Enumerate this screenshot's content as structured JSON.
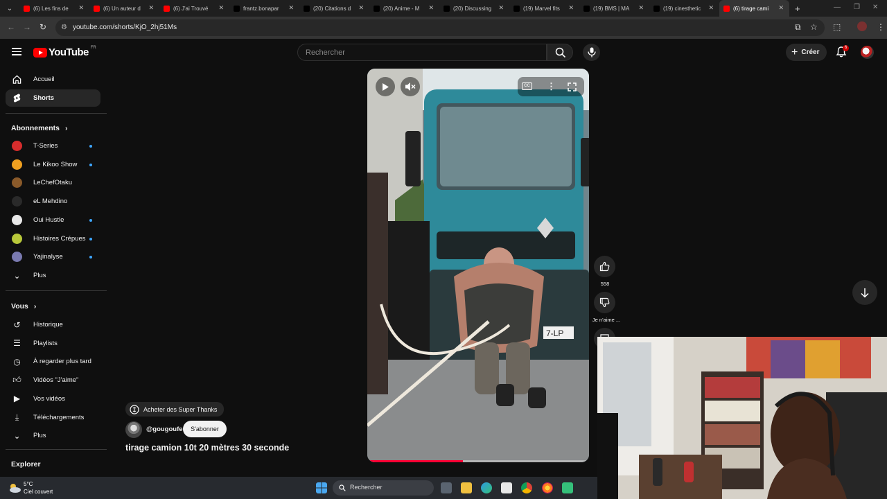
{
  "browser": {
    "tabs": [
      {
        "title": "(6) Les fins de",
        "icon": "youtube-icon",
        "color": "#ff0000"
      },
      {
        "title": "(6) Un auteur d",
        "icon": "youtube-icon",
        "color": "#ff0000"
      },
      {
        "title": "(6) J'ai Trouvé",
        "icon": "youtube-icon",
        "color": "#ff0000"
      },
      {
        "title": "frantz.bonapar",
        "icon": "tiktok-icon",
        "color": "#000000"
      },
      {
        "title": "(20) Citations d",
        "icon": "x-icon",
        "color": "#000000"
      },
      {
        "title": "(20) Anime - M",
        "icon": "x-icon",
        "color": "#000000"
      },
      {
        "title": "(20) Discussing",
        "icon": "x-icon",
        "color": "#000000"
      },
      {
        "title": "(19) Marvel fits",
        "icon": "x-icon",
        "color": "#000000"
      },
      {
        "title": "(19) BMS | MA",
        "icon": "x-icon",
        "color": "#000000"
      },
      {
        "title": "(19) cinesthetic",
        "icon": "x-icon",
        "color": "#000000"
      },
      {
        "title": "(6) tirage cami",
        "icon": "youtube-icon",
        "color": "#ff0000",
        "active": true
      }
    ],
    "url": "youtube.com/shorts/KjO_2hj51Ms"
  },
  "header": {
    "logo_text": "YouTube",
    "region": "FR",
    "search_placeholder": "Rechercher",
    "create_label": "Créer",
    "notification_count": "6"
  },
  "sidebar": {
    "main": [
      {
        "label": "Accueil",
        "icon": "home-icon"
      },
      {
        "label": "Shorts",
        "icon": "shorts-icon",
        "active": true
      }
    ],
    "subscriptions_heading": "Abonnements",
    "subscriptions": [
      {
        "label": "T-Series",
        "color": "#d62d2d",
        "new": true
      },
      {
        "label": "Le Kikoo Show",
        "color": "#f0a020",
        "new": true
      },
      {
        "label": "LeChefOtaku",
        "color": "#8a5a2a",
        "new": false
      },
      {
        "label": "eL Mehdino",
        "color": "#2a2a2a",
        "new": false
      },
      {
        "label": "Oui Hustle",
        "color": "#e9e9e9",
        "new": true
      },
      {
        "label": "Histoires Crépues",
        "color": "#b8c83a",
        "new": true
      },
      {
        "label": "Yajinalyse",
        "color": "#7a7ab0",
        "new": true
      }
    ],
    "subscriptions_more": "Plus",
    "you_heading": "Vous",
    "you_items": [
      {
        "label": "Historique",
        "icon": "history-icon"
      },
      {
        "label": "Playlists",
        "icon": "playlists-icon"
      },
      {
        "label": "À regarder plus tard",
        "icon": "watch-later-icon"
      },
      {
        "label": "Vidéos \"J'aime\"",
        "icon": "liked-icon"
      },
      {
        "label": "Vos vidéos",
        "icon": "your-videos-icon"
      },
      {
        "label": "Téléchargements",
        "icon": "download-icon"
      },
      {
        "label": "Plus",
        "icon": "chevron-down-icon"
      }
    ],
    "explore_heading": "Explorer"
  },
  "short": {
    "like_count": "558",
    "dislike_label": "Je n'aime ...",
    "super_thanks_label": "Acheter des Super Thanks",
    "channel": "@gougoufe",
    "subscribe_label": "S'abonner",
    "title": "tirage camion 10t 20 mètres 30 seconde",
    "progress": 0.43,
    "plate_text": "7-LP"
  },
  "taskbar": {
    "temperature": "5°C",
    "weather": "Ciel couvert",
    "search_label": "Rechercher"
  },
  "colors": {
    "background": "#0f0f0f",
    "accent": "#ff0000",
    "badge": "#cc0000",
    "new_dot": "#3ea6ff"
  }
}
